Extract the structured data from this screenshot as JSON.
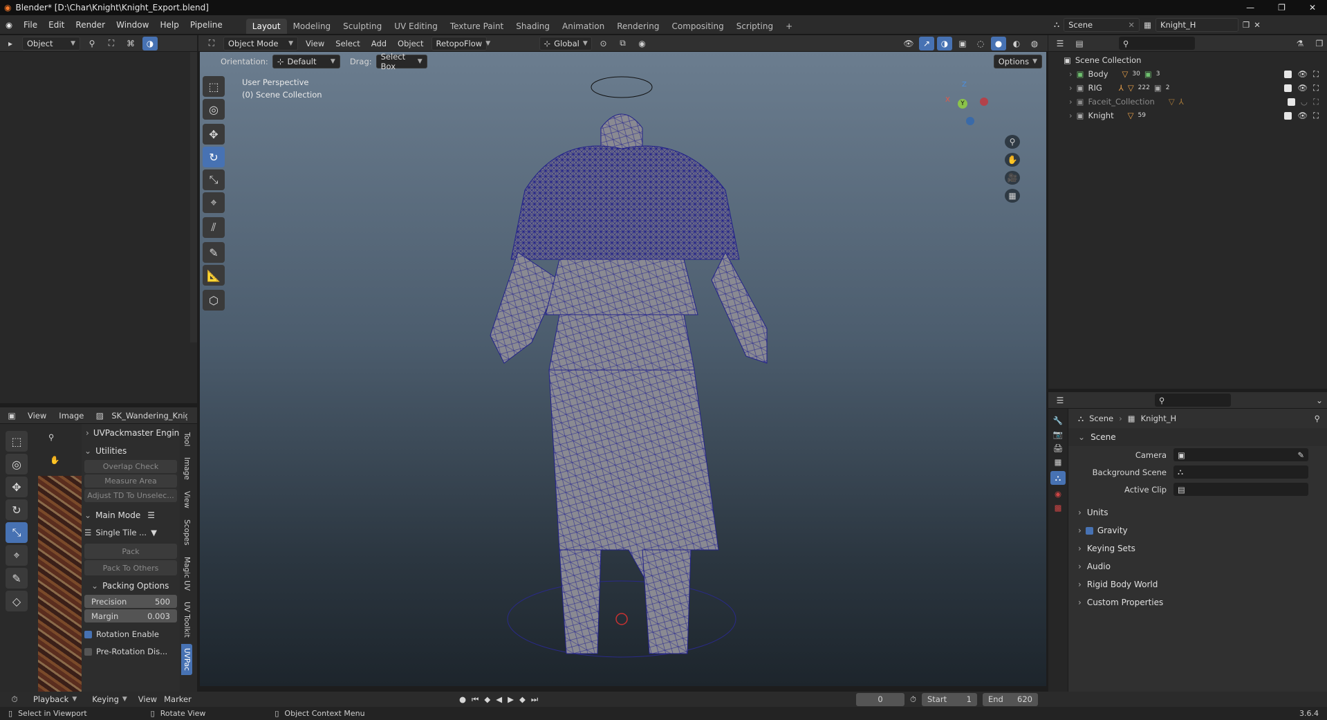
{
  "titlebar": {
    "title": "Blender* [D:\\Char\\Knight\\Knight_Export.blend]"
  },
  "menus": [
    "File",
    "Edit",
    "Render",
    "Window",
    "Help",
    "Pipeline"
  ],
  "workspaces": [
    "Layout",
    "Modeling",
    "Sculpting",
    "UV Editing",
    "Texture Paint",
    "Shading",
    "Animation",
    "Rendering",
    "Compositing",
    "Scripting"
  ],
  "active_workspace": "Layout",
  "scene_selector": {
    "scene": "Scene",
    "view_layer": "Knight_H"
  },
  "left_header": {
    "mode": "Object"
  },
  "viewport_header": {
    "mode": "Object Mode",
    "menus": [
      "View",
      "Select",
      "Add",
      "Object"
    ],
    "retopoflow": "RetopoFlow",
    "transform": "Global"
  },
  "tool_settings": {
    "orientation_label": "Orientation:",
    "orientation": "Default",
    "drag_label": "Drag:",
    "drag": "Select Box",
    "options": "Options"
  },
  "viewport": {
    "perspective": "User Perspective",
    "collection": "(0) Scene Collection"
  },
  "gizmo": {
    "x": "X",
    "y": "Y",
    "z": "Z"
  },
  "outliner": {
    "root": "Scene Collection",
    "items": [
      {
        "name": "Body",
        "extra1": "30",
        "extra2": "3",
        "hidden": false
      },
      {
        "name": "RIG",
        "extra1": "222",
        "extra2": "2",
        "hidden": false
      },
      {
        "name": "Faceit_Collection",
        "extra1": "",
        "extra2": "",
        "hidden": true
      },
      {
        "name": "Knight",
        "extra1": "59",
        "extra2": "",
        "hidden": false
      }
    ]
  },
  "properties": {
    "breadcrumb_scene": "Scene",
    "breadcrumb_layer": "Knight_H",
    "section": "Scene",
    "fields": [
      {
        "label": "Camera"
      },
      {
        "label": "Background Scene"
      },
      {
        "label": "Active Clip"
      }
    ],
    "subpanels": [
      "Units",
      "Gravity",
      "Keying Sets",
      "Audio",
      "Rigid Body World",
      "Custom Properties"
    ],
    "gravity_checked": true
  },
  "image_editor": {
    "menus": [
      "View",
      "Image"
    ],
    "image_name": "SK_Wandering_Knig",
    "uvpackmaster": "UVPackmaster Engin",
    "utilities": "Utilities",
    "utility_buttons": [
      "Overlap Check",
      "Measure Area",
      "Adjust TD To Unselec..."
    ],
    "main_mode": "Main Mode",
    "single_tile": "Single Tile ...",
    "pack": "Pack",
    "pack_to_others": "Pack To Others",
    "packing_options": "Packing Options",
    "precision_label": "Precision",
    "precision": "500",
    "margin_label": "Margin",
    "margin": "0.003",
    "rotation_enable": "Rotation Enable",
    "pre_rotation": "Pre-Rotation Dis...",
    "tabs": [
      "Tool",
      "Image",
      "View",
      "Scopes",
      "Magic UV",
      "UV Toolkit",
      "UVPac"
    ]
  },
  "timeline": {
    "menus": [
      "Playback",
      "Keying",
      "View",
      "Marker"
    ],
    "current_frame": "0",
    "start_label": "Start",
    "start": "1",
    "end_label": "End",
    "end": "620"
  },
  "statusbar": {
    "left": "Select in Viewport",
    "mid": "Rotate View",
    "right": "Object Context Menu",
    "version": "3.6.4"
  }
}
